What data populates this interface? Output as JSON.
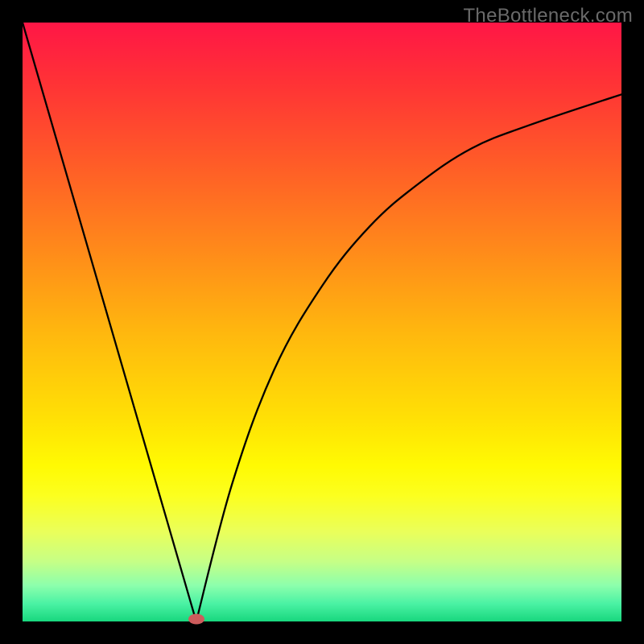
{
  "source_label": "TheBottleneck.com",
  "chart_data": {
    "type": "line",
    "title": "",
    "xlabel": "",
    "ylabel": "",
    "xlim": [
      0,
      100
    ],
    "ylim": [
      0,
      100
    ],
    "x_min_position_percent": 29,
    "curve_left": [
      {
        "x": 0,
        "y": 100
      },
      {
        "x": 29,
        "y": 0
      }
    ],
    "curve_right": [
      {
        "x": 29,
        "y": 0
      },
      {
        "x": 35,
        "y": 23
      },
      {
        "x": 42,
        "y": 42
      },
      {
        "x": 50,
        "y": 56
      },
      {
        "x": 58,
        "y": 66
      },
      {
        "x": 66,
        "y": 73
      },
      {
        "x": 75,
        "y": 79
      },
      {
        "x": 85,
        "y": 83
      },
      {
        "x": 100,
        "y": 88
      }
    ],
    "marker": {
      "x_percent": 29,
      "y_percent": 0,
      "color": "#cd5c5c"
    },
    "background_gradient_stops": [
      {
        "pos": 0,
        "color": "#ff1646"
      },
      {
        "pos": 10,
        "color": "#ff3236"
      },
      {
        "pos": 23,
        "color": "#ff5a28"
      },
      {
        "pos": 38,
        "color": "#ff8a1a"
      },
      {
        "pos": 52,
        "color": "#ffb80e"
      },
      {
        "pos": 66,
        "color": "#ffe005"
      },
      {
        "pos": 74,
        "color": "#fffa03"
      },
      {
        "pos": 79,
        "color": "#fcff1f"
      },
      {
        "pos": 85,
        "color": "#eaff5a"
      },
      {
        "pos": 90,
        "color": "#c6ff86"
      },
      {
        "pos": 94,
        "color": "#8cffac"
      },
      {
        "pos": 97,
        "color": "#4bf2a4"
      },
      {
        "pos": 100,
        "color": "#18d77e"
      }
    ]
  }
}
